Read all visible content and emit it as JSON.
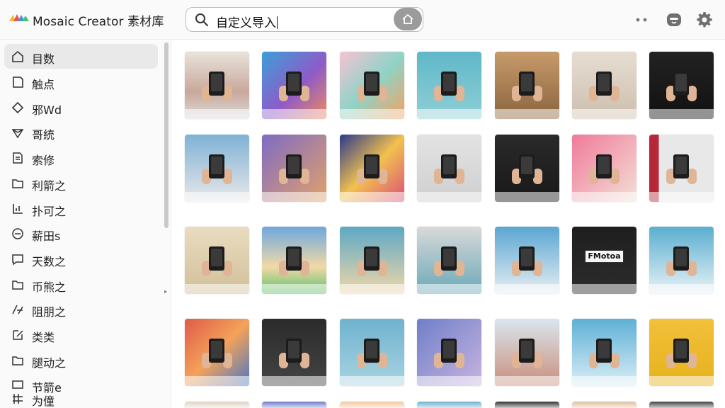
{
  "header": {
    "app_title": "Mosaic Creator 素材库",
    "search": {
      "value": "自定义导入"
    },
    "logo_icon": "mosaic-logo-icon",
    "icons": [
      "more-icon",
      "face-icon",
      "gear-icon"
    ]
  },
  "sidebar": {
    "items": [
      {
        "label": "目数",
        "icon": "home-icon",
        "active": true
      },
      {
        "label": "触点",
        "icon": "bookmark-icon"
      },
      {
        "label": "邪Wd",
        "icon": "diamond-icon"
      },
      {
        "label": "哥統",
        "icon": "gem-icon"
      },
      {
        "label": "索修",
        "icon": "file-icon"
      },
      {
        "label": "利箭之",
        "icon": "folder-icon"
      },
      {
        "label": "扑可之",
        "icon": "chart-icon"
      },
      {
        "label": "薪田s",
        "icon": "clock-icon"
      },
      {
        "label": "天数之",
        "icon": "chat-icon"
      },
      {
        "label": "币熊之",
        "icon": "folder-icon"
      },
      {
        "label": "阻朋之",
        "icon": "slash-icon"
      },
      {
        "label": "类类",
        "icon": "edit-icon"
      },
      {
        "label": "腿动之",
        "icon": "folder-icon"
      },
      {
        "label": "节箭e",
        "icon": "comment-icon"
      },
      {
        "label": "为僮",
        "icon": "grid-icon"
      }
    ]
  },
  "grid": {
    "badge_text": "FMotoa",
    "colors": {
      "accent": "#9b9b9b",
      "sidebar_active": "#e9e9e9"
    }
  }
}
